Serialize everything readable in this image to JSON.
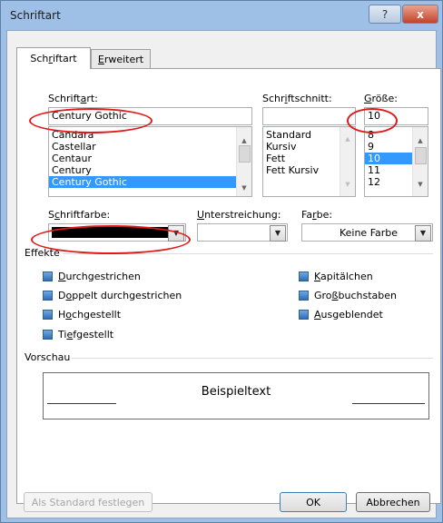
{
  "window": {
    "title": "Schriftart",
    "help_label": "?",
    "close_label": "x"
  },
  "tabs": [
    {
      "label": "Schriftart",
      "mnemonic": "r",
      "active": true
    },
    {
      "label": "Erweitert",
      "mnemonic": "E",
      "active": false
    }
  ],
  "font": {
    "label": "Schriftart:",
    "value": "Century Gothic",
    "items": [
      "Candara",
      "Castellar",
      "Centaur",
      "Century",
      "Century Gothic"
    ],
    "selected": "Century Gothic"
  },
  "style": {
    "label": "Schriftschnitt:",
    "value": "",
    "items": [
      "Standard",
      "Kursiv",
      "Fett",
      "Fett Kursiv"
    ]
  },
  "size": {
    "label": "Größe:",
    "value": "10",
    "items": [
      "8",
      "9",
      "10",
      "11",
      "12"
    ],
    "selected": "10"
  },
  "font_color": {
    "label": "Schriftfarbe:",
    "value_color": "#000000"
  },
  "underline": {
    "label": "Unterstreichung:",
    "value": ""
  },
  "underline_color": {
    "label": "Farbe:",
    "value": "Keine Farbe"
  },
  "effects": {
    "title": "Effekte",
    "left": [
      "Durchgestrichen",
      "Doppelt durchgestrichen",
      "Hochgestellt",
      "Tiefgestellt"
    ],
    "right": [
      "Kapitälchen",
      "Großbuchstaben",
      "Ausgeblendet"
    ]
  },
  "preview": {
    "title": "Vorschau",
    "sample": "Beispieltext"
  },
  "buttons": {
    "default": "Als Standard festlegen",
    "ok": "OK",
    "cancel": "Abbrechen"
  },
  "colors": {
    "selection": "#3399ff",
    "annotation": "#e01919",
    "frame": "#9fc0e6"
  }
}
